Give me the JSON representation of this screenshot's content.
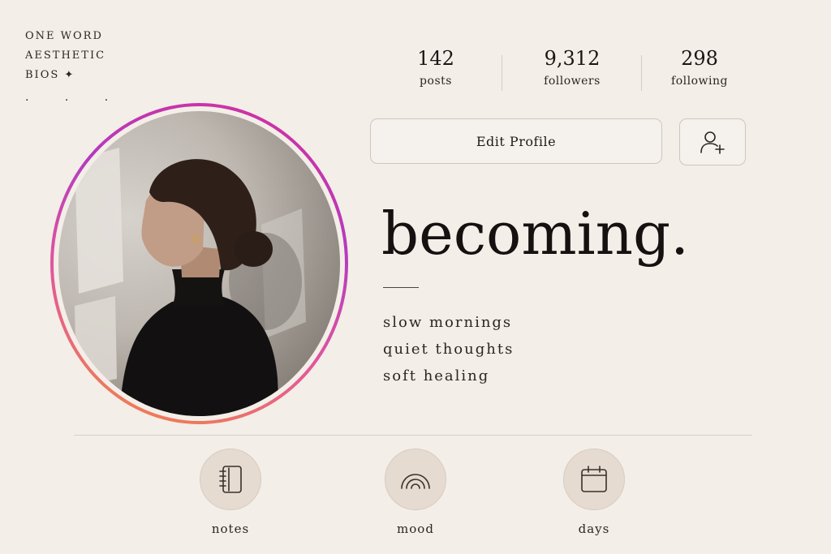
{
  "header": {
    "title_lines": [
      "ONE WORD",
      "AESTHETIC",
      "BIOS ✦"
    ],
    "dots": ". . ."
  },
  "stats": [
    {
      "value": "142",
      "label": "posts"
    },
    {
      "value": "9,312",
      "label": "followers"
    },
    {
      "value": "298",
      "label": "following"
    }
  ],
  "actions": {
    "edit_profile_label": "Edit Profile",
    "add_user_icon": "add-user-icon"
  },
  "profile": {
    "headline": "becoming.",
    "bio_lines": [
      "slow mornings",
      "quiet thoughts",
      "soft healing"
    ]
  },
  "highlights": [
    {
      "label": "notes",
      "icon": "notebook-icon"
    },
    {
      "label": "mood",
      "icon": "rainbow-icon"
    },
    {
      "label": "days",
      "icon": "calendar-icon"
    }
  ],
  "colors": {
    "background": "#f3eee8",
    "story_ring_start": "#f28a3f",
    "story_ring_end": "#b43bbf",
    "highlight_fill": "#e6dbd1"
  }
}
